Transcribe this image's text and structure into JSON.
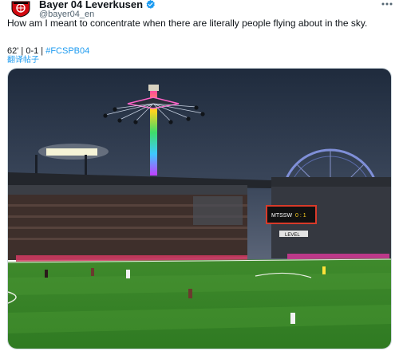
{
  "author": {
    "name": "Bayer 04 Leverkusen",
    "handle": "@bayer04_en",
    "verified": true,
    "avatar_icon": "bayer-04-crest-icon"
  },
  "tweet": {
    "text": "How am I meant to concentrate when there are literally people flying about in the sky.",
    "match_minute": "62'",
    "score": "0-1",
    "separator": "|",
    "hashtag": "#FCSPB04",
    "translate_label": "翻译帖子"
  },
  "media": {
    "scoreboard": {
      "left": "MTSSW",
      "score": "0 : 1"
    },
    "ad_board": "LEVEL",
    "icons": [
      "chair-swing-ride",
      "ferris-wheel",
      "floodlights",
      "football-pitch"
    ]
  },
  "colors": {
    "link": "#1d9bf0",
    "verified": "#1d9bf0",
    "pitch": "#3f8a2c",
    "sky": "#2a3547",
    "crest_red": "#d20a11"
  }
}
